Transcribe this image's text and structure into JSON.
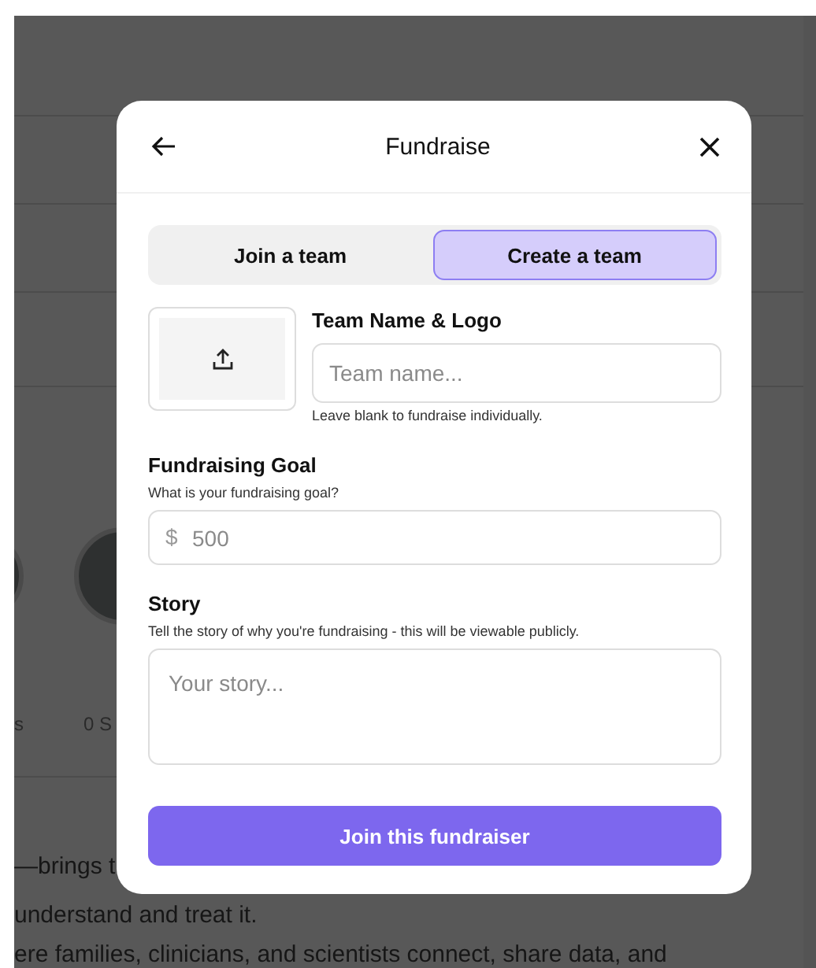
{
  "background": {
    "stat_texts": [
      "s",
      "0 S"
    ],
    "paragraphs": [
      "—brings t",
      "understand and treat it.",
      "ere families, clinicians, and scientists connect, share data, and"
    ]
  },
  "modal": {
    "title": "Fundraise",
    "tabs": [
      {
        "label": "Join a team",
        "selected": false
      },
      {
        "label": "Create a team",
        "selected": true
      }
    ],
    "team": {
      "label": "Team Name & Logo",
      "placeholder": "Team name...",
      "hint": "Leave blank to fundraise individually."
    },
    "goal": {
      "label": "Fundraising Goal",
      "hint": "What is your fundraising goal?",
      "currency": "$",
      "placeholder": "500"
    },
    "story": {
      "label": "Story",
      "hint": "Tell the story of why you're fundraising - this will be viewable publicly.",
      "placeholder": "Your story..."
    },
    "submit": "Join this fundraiser"
  }
}
